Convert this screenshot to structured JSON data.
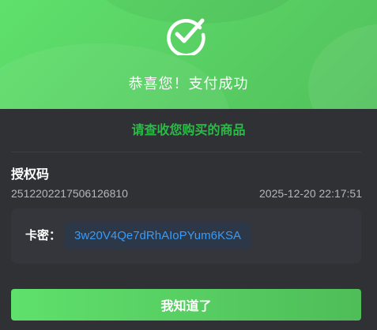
{
  "header": {
    "title": "恭喜您！支付成功",
    "icon": "check-circle-icon",
    "accent_color": "#5fe06c"
  },
  "subtitle": "请查收您购买的商品",
  "order": {
    "label": "授权码",
    "number": "2512202217506126810",
    "time": "2025-12-20 22:17:51"
  },
  "card": {
    "label": "卡密：",
    "code": "3w20V4Qe7dRhAIoPYum6KSA",
    "code_color": "#3b9af5"
  },
  "button": {
    "label": "我知道了"
  }
}
